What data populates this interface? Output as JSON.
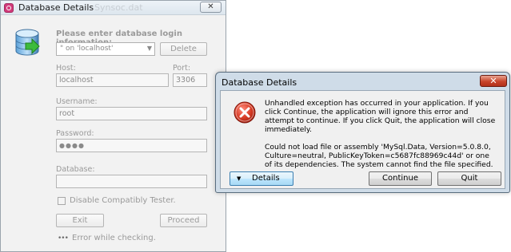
{
  "login_window": {
    "title": "Database Details",
    "ghost_title": "Synsoc.dat",
    "close_label": "✕",
    "heading": "Please enter database login information:",
    "connection": {
      "selected": "\" on 'localhost'"
    },
    "delete_label": "Delete",
    "host_label": "Host:",
    "host_value": "localhost",
    "port_label": "Port:",
    "port_value": "3306",
    "username_label": "Username:",
    "username_value": "root",
    "password_label": "Password:",
    "password_value": "●●●●",
    "database_label": "Database:",
    "database_value": "",
    "checkbox_label": "Disable Compatibly Tester.",
    "exit_label": "Exit",
    "proceed_label": "Proceed",
    "status_icon": "•••",
    "status_text": "Error while checking."
  },
  "error_dialog": {
    "title": "Database Details",
    "close_label": "✕",
    "message_1": "Unhandled exception has occurred in your application. If you click Continue, the application will ignore this error and attempt to continue. If you click Quit, the application will close immediately.",
    "message_2": "Could not load file or assembly 'MySql.Data, Version=5.0.8.0, Culture=neutral, PublicKeyToken=c5687fc88969c44d' or one of its dependencies. The system cannot find the file specified.",
    "details_label": "Details",
    "continue_label": "Continue",
    "quit_label": "Quit"
  },
  "icons": {
    "app": "app-icon",
    "database": "database-icon",
    "error": "error-icon"
  },
  "colors": {
    "accent_blue": "#3c7fb1",
    "error_red": "#c8452b",
    "disabled_text": "#9a9a9a"
  }
}
